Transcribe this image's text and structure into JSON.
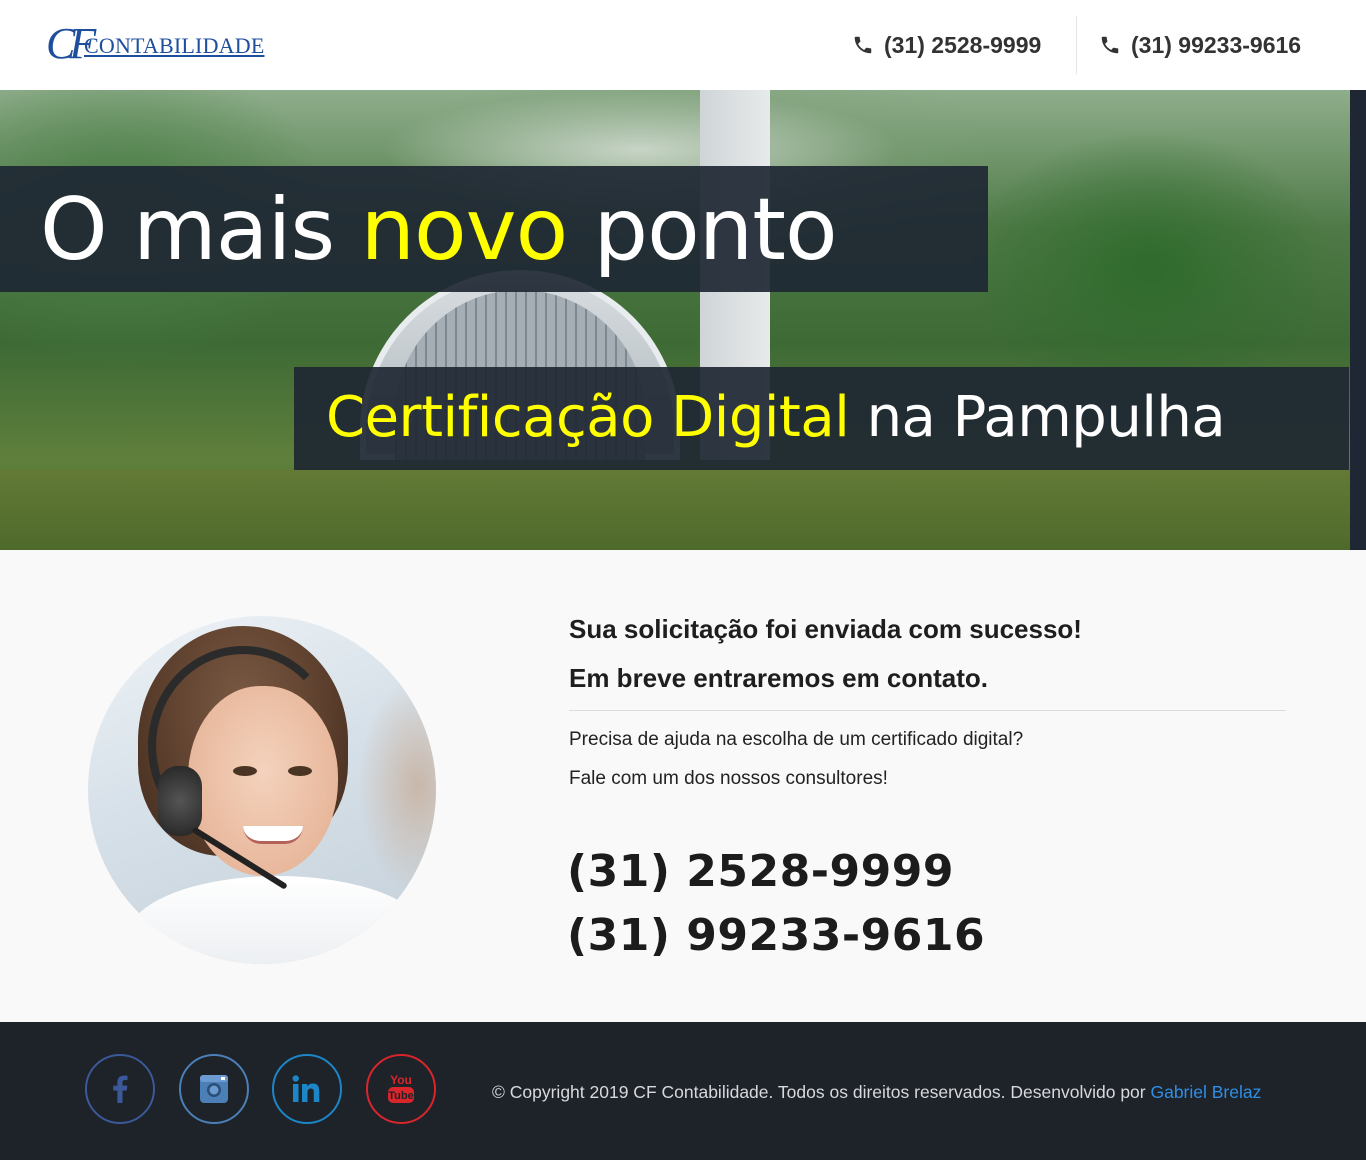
{
  "header": {
    "logo_mark": "CF",
    "logo_text": "CONTABILIDADE",
    "phone_1": "(31) 2528-9999",
    "phone_2": "(31) 99233-9616",
    "phone_icon": "phone-icon"
  },
  "hero": {
    "headline_pre": "O mais ",
    "headline_highlight": "novo",
    "headline_post": " ponto",
    "subline_highlight": "Certificação Digital",
    "subline_post": " na Pampulha",
    "highlight_color": "#ffff00",
    "banner_color": "#1e2733"
  },
  "main": {
    "success_line_1": "Sua solicitação foi enviada com sucesso!",
    "success_line_2": "Em breve entraremos em contato.",
    "help_line_1": "Precisa de ajuda na escolha de um certificado digital?",
    "help_line_2": "Fale com um dos nossos consultores!",
    "phone_1": "(31) 2528-9999",
    "phone_2": "(31) 99233-9616"
  },
  "footer": {
    "social": [
      {
        "name": "facebook-icon",
        "color": "#3b5998"
      },
      {
        "name": "instagram-icon",
        "color": "#4b7fb5"
      },
      {
        "name": "linkedin-icon",
        "color": "#1c86c6"
      },
      {
        "name": "youtube-icon",
        "color": "#d8262a"
      }
    ],
    "youtube_you": "You",
    "youtube_tube": "Tube",
    "copyright_text": "© Copyright 2019 CF Contabilidade. Todos os direitos reservados. Desenvolvido por ",
    "developer_link": "Gabriel Brelaz",
    "link_color": "#2f8fe5",
    "background": "#1e2229"
  }
}
